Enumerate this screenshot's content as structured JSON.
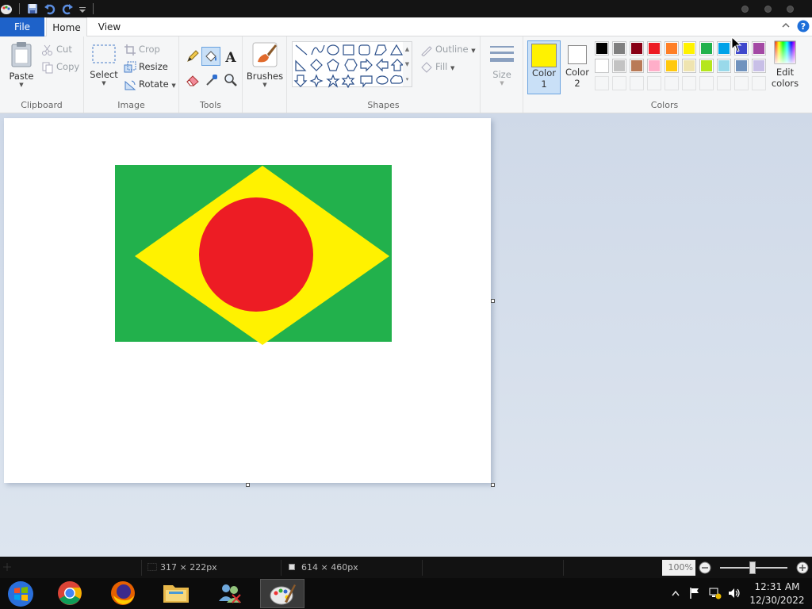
{
  "titlebar": {},
  "tabs": {
    "file": "File",
    "home": "Home",
    "view": "View"
  },
  "clipboard": {
    "paste": "Paste",
    "cut": "Cut",
    "copy": "Copy",
    "label": "Clipboard"
  },
  "image": {
    "select": "Select",
    "crop": "Crop",
    "resize": "Resize",
    "rotate": "Rotate",
    "label": "Image"
  },
  "tools": {
    "label": "Tools"
  },
  "brushes": {
    "label": "Brushes"
  },
  "shapes": {
    "outline": "Outline",
    "fill": "Fill",
    "label": "Shapes"
  },
  "size": {
    "label": "Size"
  },
  "colors": {
    "color1_line1": "Color",
    "color1_line2": "1",
    "color2_line1": "Color",
    "color2_line2": "2",
    "edit_line1": "Edit",
    "edit_line2": "colors",
    "label": "Colors",
    "color1_value": "#fff200",
    "color2_value": "#ffffff",
    "palette_row1": [
      "#000000",
      "#7f7f7f",
      "#880015",
      "#ed1c24",
      "#ff7f27",
      "#fff200",
      "#22b14c",
      "#00a2e8",
      "#3f48cc",
      "#a349a4"
    ],
    "palette_row2": [
      "#ffffff",
      "#c3c3c3",
      "#b97a57",
      "#ffaec9",
      "#ffc90e",
      "#efe4b0",
      "#b5e61d",
      "#99d9ea",
      "#7092be",
      "#c8bfe7"
    ]
  },
  "flag_drawing": {
    "background": "#22b14c",
    "diamond": "#fff200",
    "circle": "#ed1c24"
  },
  "status": {
    "cursor_pos": "",
    "selection_size": "317 × 222px",
    "image_size": "614 × 460px",
    "zoom": "100%"
  },
  "taskbar": {
    "time": "12:31 AM",
    "date": "12/30/2022"
  }
}
